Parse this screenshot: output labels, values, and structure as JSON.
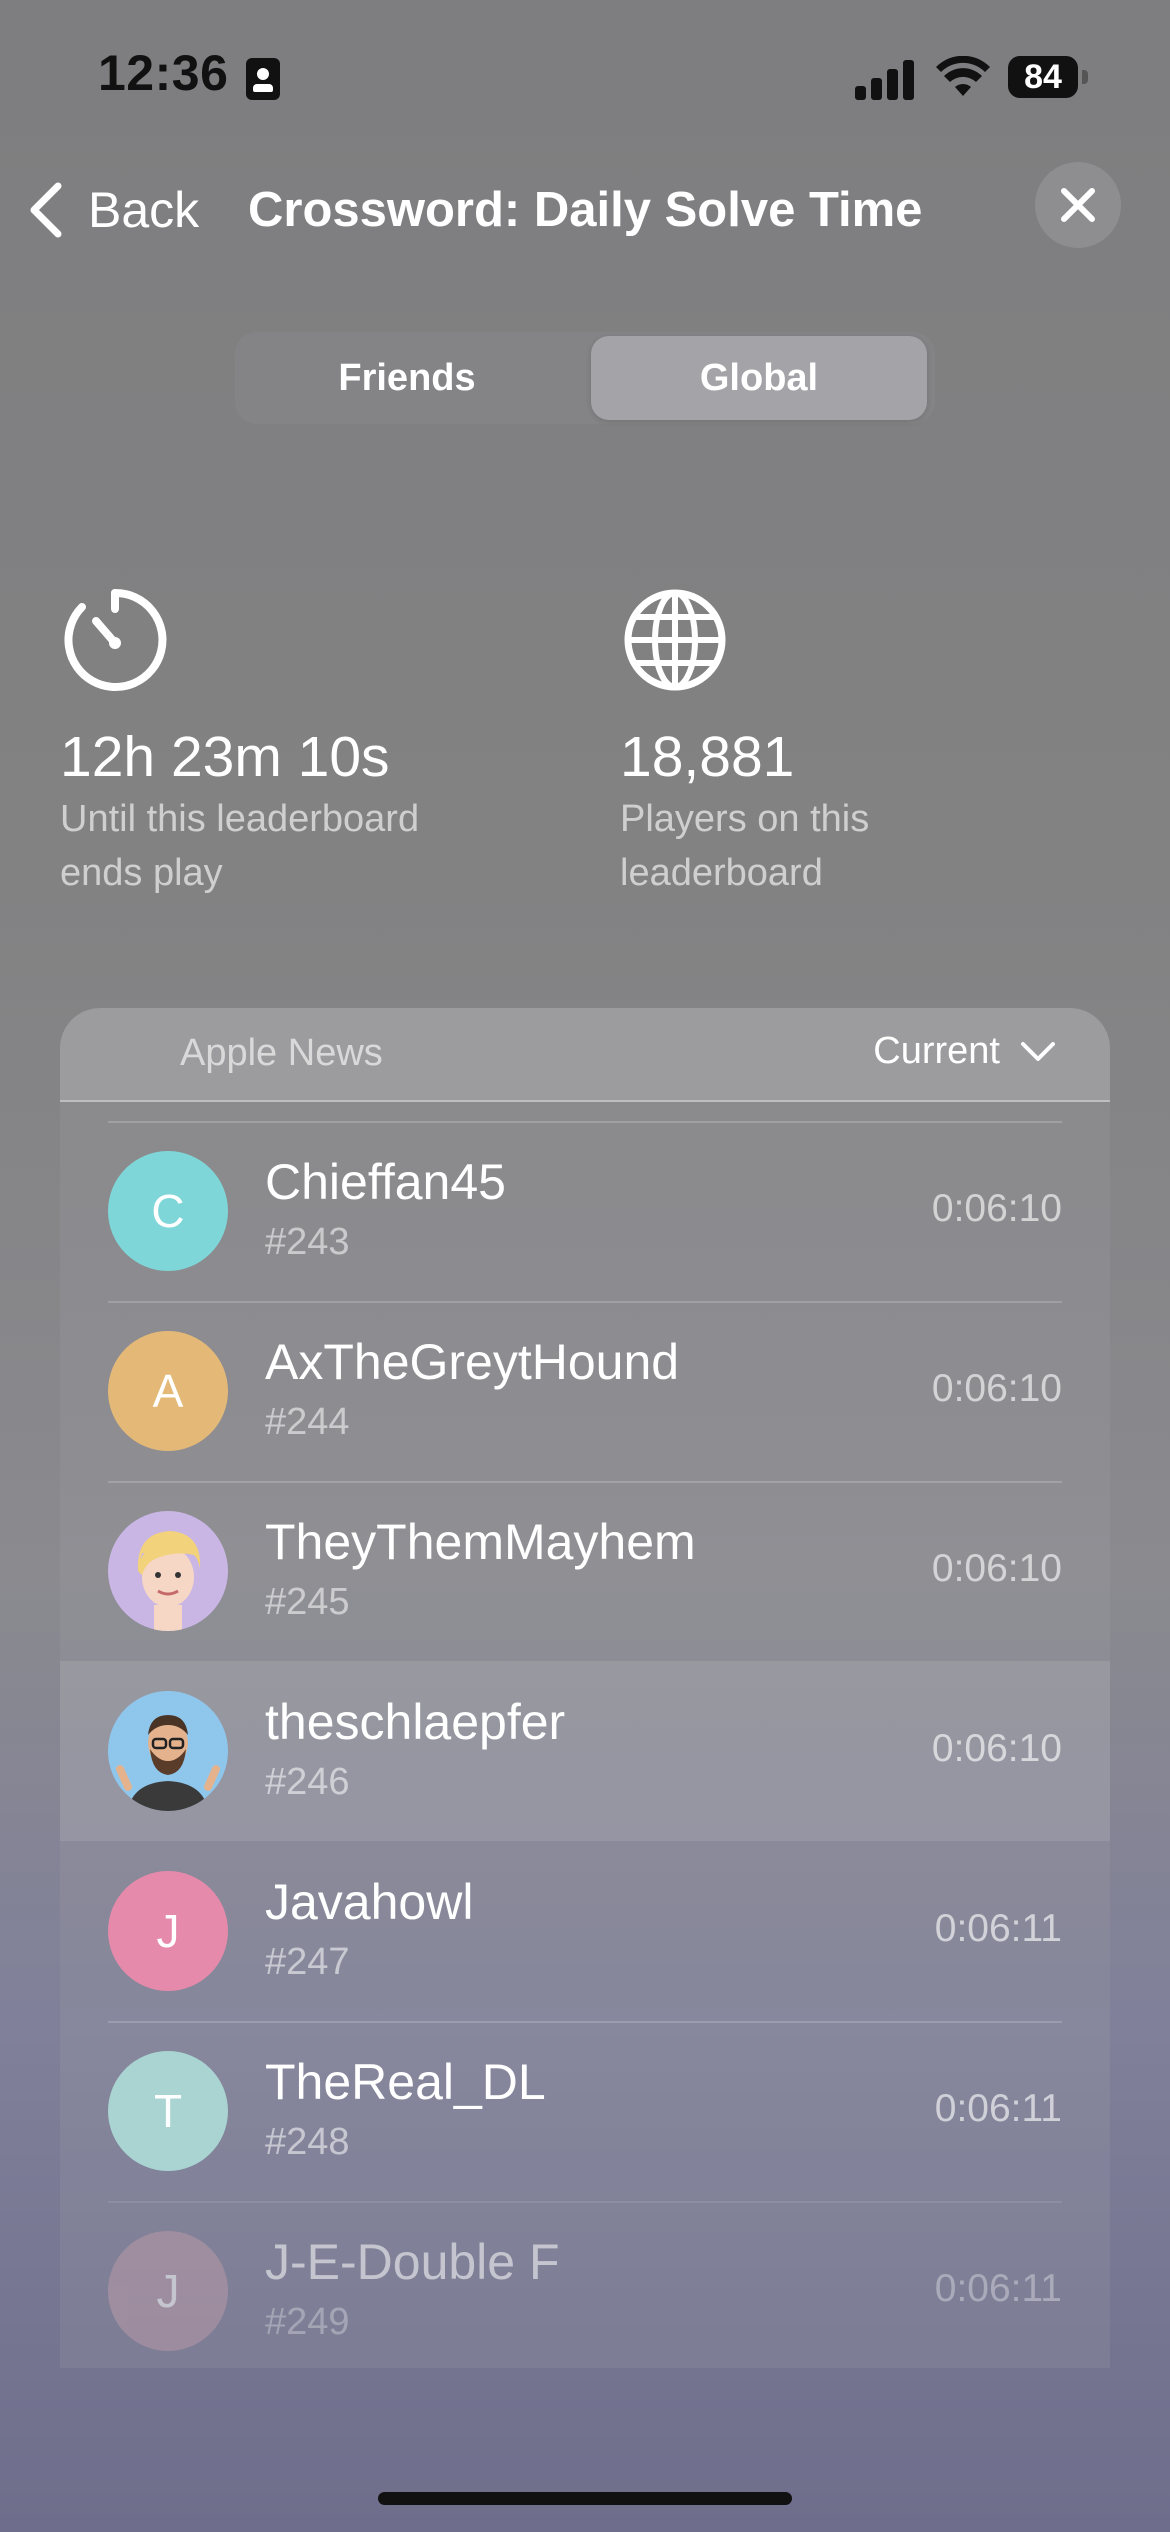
{
  "status_bar": {
    "time": "12:36",
    "battery": "84"
  },
  "nav": {
    "back_label": "Back",
    "title": "Crossword: Daily Solve Time"
  },
  "segments": {
    "friends": "Friends",
    "global": "Global",
    "selected": "Global"
  },
  "stats": {
    "countdown_value": "12h 23m 10s",
    "countdown_caption_line1": "Until this leaderboard",
    "countdown_caption_line2": "ends play",
    "players_value": "18,881",
    "players_caption_line1": "Players on this",
    "players_caption_line2": "leaderboard"
  },
  "leaderboard": {
    "source": "Apple News",
    "filter": "Current",
    "rows": [
      {
        "initial": "C",
        "name": "Chieffan45",
        "rank": "#243",
        "time": "0:06:10",
        "avatar_color": "#7fd6d8"
      },
      {
        "initial": "A",
        "name": "AxTheGreytHound",
        "rank": "#244",
        "time": "0:06:10",
        "avatar_color": "#e4b978"
      },
      {
        "initial": "",
        "name": "TheyThemMayhem",
        "rank": "#245",
        "time": "0:06:10",
        "avatar_color": "#c9b6e4"
      },
      {
        "initial": "",
        "name": "theschlaepfer",
        "rank": "#246",
        "time": "0:06:10",
        "avatar_color": "#8fc7ec"
      },
      {
        "initial": "J",
        "name": "Javahowl",
        "rank": "#247",
        "time": "0:06:11",
        "avatar_color": "#e58aaa"
      },
      {
        "initial": "T",
        "name": "TheReal_DL",
        "rank": "#248",
        "time": "0:06:11",
        "avatar_color": "#a9d4d2"
      },
      {
        "initial": "J",
        "name": "J-E-Double F",
        "rank": "#249",
        "time": "0:06:11",
        "avatar_color": "#b89aa8"
      }
    ]
  }
}
